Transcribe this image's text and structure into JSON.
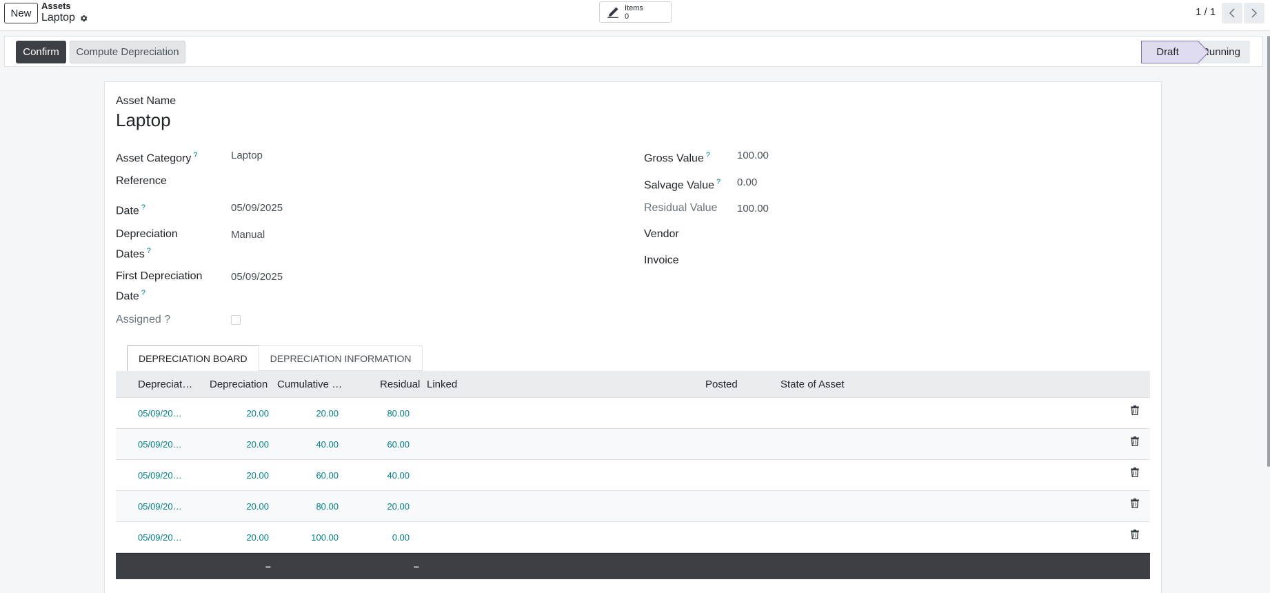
{
  "control_panel": {
    "new_label": "New",
    "breadcrumb_parent": "Assets",
    "breadcrumb_current": "Laptop",
    "smart_button": {
      "label": "Items",
      "count": "0"
    },
    "pager": "1 / 1"
  },
  "status_bar": {
    "confirm_label": "Confirm",
    "compute_label": "Compute Depreciation",
    "stages": [
      "Draft",
      "Running"
    ],
    "active_stage": "Draft"
  },
  "form": {
    "title_label": "Asset Name",
    "title_value": "Laptop",
    "left": {
      "asset_category": {
        "label": "Asset Category",
        "help": "?",
        "value": "Laptop"
      },
      "reference": {
        "label": "Reference",
        "value": ""
      },
      "date": {
        "label": "Date",
        "help": "?",
        "value": "05/09/2025"
      },
      "depreciation_dates": {
        "label_1": "Depreciation",
        "label_2": "Dates",
        "help": "?",
        "value": "Manual"
      },
      "first_depreciation_date": {
        "label_1": "First Depreciation",
        "label_2": "Date",
        "help": "?",
        "value": "05/09/2025"
      },
      "assigned": {
        "label": "Assigned ?",
        "checked": false
      }
    },
    "right": {
      "gross_value": {
        "label": "Gross Value",
        "help": "?",
        "value": "100.00"
      },
      "salvage_value": {
        "label": "Salvage Value",
        "help": "?",
        "value": "0.00"
      },
      "residual_value": {
        "label": "Residual Value",
        "value": "100.00"
      },
      "vendor": {
        "label": "Vendor",
        "value": ""
      },
      "invoice": {
        "label": "Invoice",
        "value": ""
      }
    }
  },
  "notebook": {
    "tabs": [
      "DEPRECIATION BOARD",
      "DEPRECIATION INFORMATION"
    ],
    "active_tab": "DEPRECIATION BOARD",
    "columns": [
      "Depreciat…",
      "Depreciation",
      "Cumulative …",
      "Residual",
      "Linked",
      "Posted",
      "State of Asset"
    ],
    "rows": [
      {
        "date": "05/09/20…",
        "depreciation": "20.00",
        "cumulative": "20.00",
        "residual": "80.00"
      },
      {
        "date": "05/09/20…",
        "depreciation": "20.00",
        "cumulative": "40.00",
        "residual": "60.00"
      },
      {
        "date": "05/09/20…",
        "depreciation": "20.00",
        "cumulative": "60.00",
        "residual": "40.00"
      },
      {
        "date": "05/09/20…",
        "depreciation": "20.00",
        "cumulative": "80.00",
        "residual": "20.00"
      },
      {
        "date": "05/09/20…",
        "depreciation": "20.00",
        "cumulative": "100.00",
        "residual": "0.00"
      }
    ],
    "footer": {
      "depreciation_total": "–",
      "residual_total": "–"
    }
  },
  "icons": {
    "settings": "gear-icon",
    "edit": "pencil-icon",
    "prev": "chevron-left-icon",
    "next": "chevron-right-icon",
    "delete": "trash-icon"
  },
  "colors": {
    "primary_dark": "#3c3f44",
    "link_teal": "#017e84",
    "active_stage": "#e0dcf0"
  }
}
